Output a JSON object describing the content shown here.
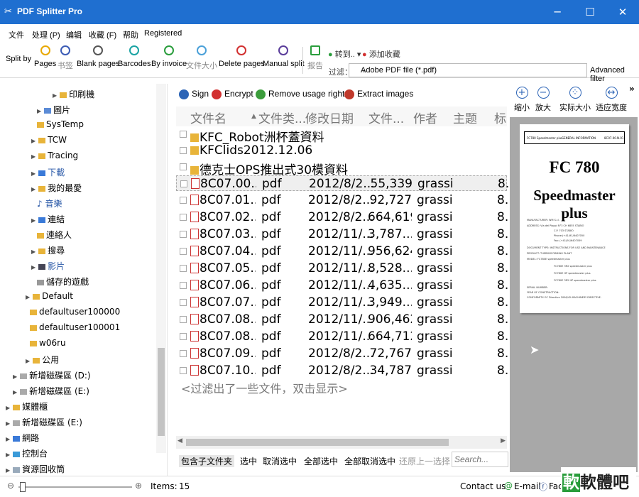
{
  "window": {
    "title": "PDF Splitter Pro",
    "minimize": "─",
    "maximize": "☐",
    "close": "✕"
  },
  "menu": [
    "文件",
    "处理 (P)",
    "编辑",
    "收藏 (F)",
    "帮助",
    "Registered"
  ],
  "toolbar": {
    "split_by": "Split by",
    "buttons": [
      {
        "label": "Pages",
        "color": "#e8a800"
      },
      {
        "label": "书签",
        "color": "#3b5bb5"
      },
      {
        "label": "Blank pages",
        "color": "#555555"
      },
      {
        "label": "Barcodes",
        "color": "#1aa3a3"
      },
      {
        "label": "By invoice",
        "color": "#2a9d3c"
      },
      {
        "label": "文件大小",
        "color": "#4aa0d8"
      },
      {
        "label": "Delete pages",
        "color": "#d23030"
      },
      {
        "label": "Manual split",
        "color": "#5a3c9a"
      },
      {
        "label": "报告",
        "color": "#2a9d3c"
      }
    ],
    "goto": "转到..",
    "add_fav": "添加收藏",
    "filter_label": "过滤：",
    "filter_value": "Adobe PDF file (*.pdf)",
    "advanced_filter": "Advanced filter"
  },
  "tree": [
    "印刷機",
    "圖片",
    "SysTemp",
    "TCW",
    "Tracing",
    "下載",
    "我的最愛",
    "音樂",
    "連結",
    "連絡人",
    "搜尋",
    "影片",
    "儲存的遊戲",
    "Default",
    "defaultuser100000",
    "defaultuser100001",
    "w06ru",
    "公用",
    "新增磁碟區 (D:)",
    "新增磁碟區 (E:)",
    "媒體櫃",
    "新增磁碟區 (E:)",
    "網路",
    "控制台",
    "資源回收筒"
  ],
  "actions": [
    "Sign",
    "Encrypt",
    "Remove usage rights",
    "Extract images"
  ],
  "file_list": {
    "headers": [
      "文件名",
      "文件类...",
      "修改日期",
      "文件...",
      "作者",
      "主题",
      "标"
    ],
    "folders": [
      "KFC_Robot洲杯蓋資料",
      "KFClids2012.12.06",
      "德克士OPS推出式30模資料"
    ],
    "files": [
      {
        "name": "8C07.00....",
        "type": "pdf",
        "date": "2012/8/2...",
        "size": "55,339",
        "author": "grassi",
        "extra": "8."
      },
      {
        "name": "8C07.01....",
        "type": "pdf",
        "date": "2012/8/2...",
        "size": "92,727",
        "author": "grassi",
        "extra": "8."
      },
      {
        "name": "8C07.02....",
        "type": "pdf",
        "date": "2012/8/2...",
        "size": "664,619",
        "author": "grassi",
        "extra": "8."
      },
      {
        "name": "8C07.03....",
        "type": "pdf",
        "date": "2012/11/...",
        "size": "3,787....",
        "author": "grassi",
        "extra": "8."
      },
      {
        "name": "8C07.04....",
        "type": "pdf",
        "date": "2012/11/...",
        "size": "956,624",
        "author": "grassi",
        "extra": "8."
      },
      {
        "name": "8C07.05....",
        "type": "pdf",
        "date": "2012/11/...",
        "size": "8,528....",
        "author": "grassi",
        "extra": "8."
      },
      {
        "name": "8C07.06....",
        "type": "pdf",
        "date": "2012/11/...",
        "size": "4,635....",
        "author": "grassi",
        "extra": "8."
      },
      {
        "name": "8C07.07....",
        "type": "pdf",
        "date": "2012/11/...",
        "size": "3,949....",
        "author": "grassi",
        "extra": "8."
      },
      {
        "name": "8C07.08....",
        "type": "pdf",
        "date": "2012/11/...",
        "size": "906,462",
        "author": "grassi",
        "extra": "8."
      },
      {
        "name": "8C07.08....",
        "type": "pdf",
        "date": "2012/11/...",
        "size": "664,712",
        "author": "grassi",
        "extra": "8."
      },
      {
        "name": "8C07.09....",
        "type": "pdf",
        "date": "2012/8/2...",
        "size": "72,767",
        "author": "grassi",
        "extra": "8."
      },
      {
        "name": "8C07.10....",
        "type": "pdf",
        "date": "2012/8/2...",
        "size": "34,787",
        "author": "grassi",
        "extra": "8."
      }
    ],
    "filtered_hint": "<过滤出了一些文件，双击显示>"
  },
  "bottom_tabs": [
    "包含子文件夹",
    "选中",
    "取消选中",
    "全部选中",
    "全部取消选中",
    "还原上一选择"
  ],
  "search_placeholder": "Search...",
  "preview": {
    "buttons": [
      "缩小",
      "放大",
      "实际大小",
      "适应宽度"
    ],
    "page": {
      "header_left": "FC780 Speedmaster plus",
      "header_mid": "GENERAL INFORMATION",
      "header_right": "8C07.00.N.01",
      "title1": "FC 780",
      "title2": "Speedmaster plus",
      "lines": [
        "MANUFACTURER:   WM S.r.l.",
        "ADDRESS:   Via dei Pioppi N°3 CH 6855 STABIO",
        "C.P. 703 STABIO",
        "Phone:(+41)91/6407050",
        "Fax: (+41)91/6407059",
        "DOCUMENT TYPE:   INSTRUCTIONS FOR USE AND MAINTENANCE",
        "PRODUCT:   THERMOFORMING PLANT",
        "MODEL:   FC780E speedmaster plus",
        "FC780E 3R2 speedmaster plus",
        "FC780E HP speedmaster plus",
        "FC780E 3R2 HP speedmaster plus",
        "SERIAL NUMBER:",
        "YEAR OF CONSTRUCTION:",
        "CONFORMITY:   EC Directive 2006/42-MACHINERY DIRECTIVE."
      ]
    }
  },
  "status": {
    "items_label": "Items:",
    "items_count": "15",
    "contact": "Contact us",
    "email": "E-mail",
    "facebook": "Faceb"
  },
  "watermark": "軟體吧"
}
